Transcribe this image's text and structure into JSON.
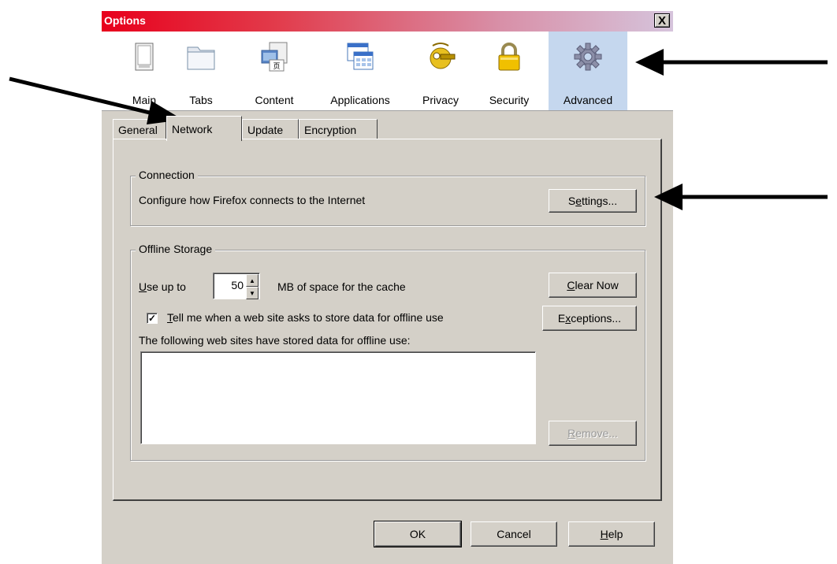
{
  "window": {
    "title": "Options",
    "close_label": "X"
  },
  "toolbar": {
    "items": [
      {
        "label": "Main",
        "icon": "main-window-icon",
        "selected": false
      },
      {
        "label": "Tabs",
        "icon": "tabs-folder-icon",
        "selected": false
      },
      {
        "label": "Content",
        "icon": "content-page-icon",
        "selected": false
      },
      {
        "label": "Applications",
        "icon": "applications-icon",
        "selected": false
      },
      {
        "label": "Privacy",
        "icon": "privacy-mask-icon",
        "selected": false
      },
      {
        "label": "Security",
        "icon": "padlock-icon",
        "selected": false
      },
      {
        "label": "Advanced",
        "icon": "gear-icon",
        "selected": true
      }
    ]
  },
  "tabs": [
    {
      "label": "General",
      "active": false
    },
    {
      "label": "Network",
      "active": true
    },
    {
      "label": "Update",
      "active": false
    },
    {
      "label": "Encryption",
      "active": false
    }
  ],
  "connection": {
    "legend": "Connection",
    "description": "Configure how Firefox connects to the Internet",
    "settings_pre": "S",
    "settings_acc": "e",
    "settings_post": "ttings..."
  },
  "offline": {
    "legend": "Offline Storage",
    "use_up_acc": "U",
    "use_up_rest": "se up to",
    "cache_value": "50",
    "mb_label": "MB of space for the cache",
    "clear_acc": "C",
    "clear_rest": "lear Now",
    "tell_checked": true,
    "tell_acc": "T",
    "tell_rest": "ell me when a web site asks to store data for offline use",
    "exceptions_pre": "E",
    "exceptions_acc": "x",
    "exceptions_post": "ceptions...",
    "sites_label": "The following web sites have stored data for offline use:",
    "remove_acc": "R",
    "remove_rest": "emove..."
  },
  "footer": {
    "ok": "OK",
    "cancel": "Cancel",
    "help_acc": "H",
    "help_rest": "elp"
  },
  "colors": {
    "title_gradient_start": "#e8001c",
    "title_gradient_end": "#d6c4dc",
    "dialog_bg": "#d4d0c8",
    "selected_toolbar_bg": "#c5d7ee"
  }
}
